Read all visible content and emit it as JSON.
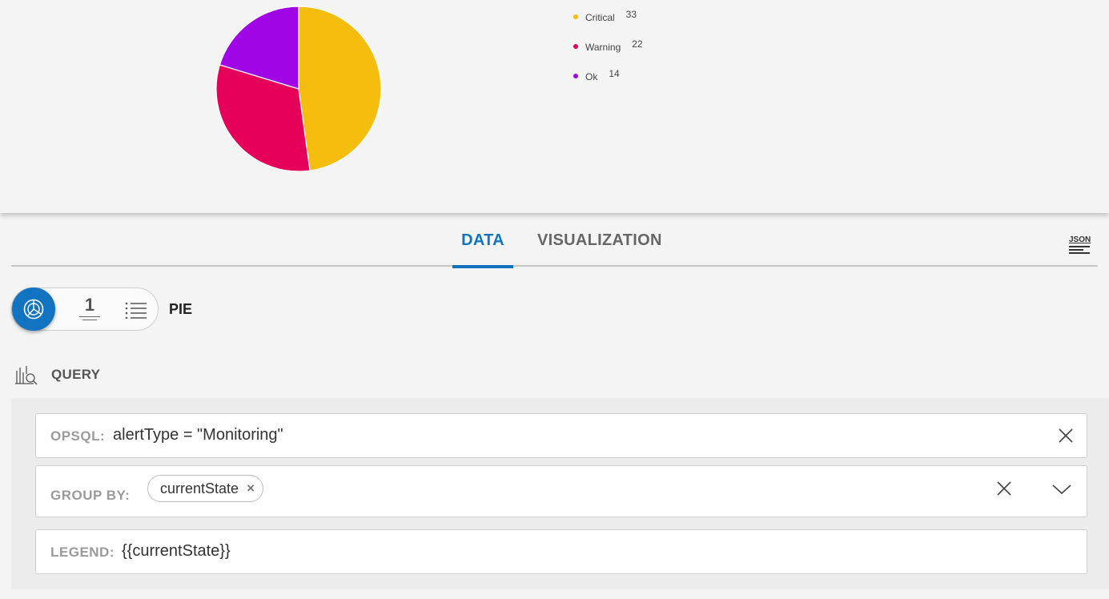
{
  "chart_data": {
    "type": "pie",
    "categories": [
      "Critical",
      "Warning",
      "Ok"
    ],
    "values": [
      33,
      22,
      14
    ],
    "colors": [
      "#f5be0e",
      "#e5005a",
      "#a005e6"
    ],
    "legend_position": "right"
  },
  "tabs": {
    "data_label": "DATA",
    "visualization_label": "VISUALIZATION",
    "json_label": "JSON"
  },
  "viz_selector": {
    "number_label": "1",
    "selected_name": "PIE"
  },
  "query": {
    "heading": "QUERY",
    "opsql_label": "OPSQL:",
    "opsql_value": "alertType = \"Monitoring\"",
    "groupby_label": "GROUP BY:",
    "groupby_chip": "currentState",
    "legend_label": "LEGEND:",
    "legend_value": "{{currentState}}"
  }
}
